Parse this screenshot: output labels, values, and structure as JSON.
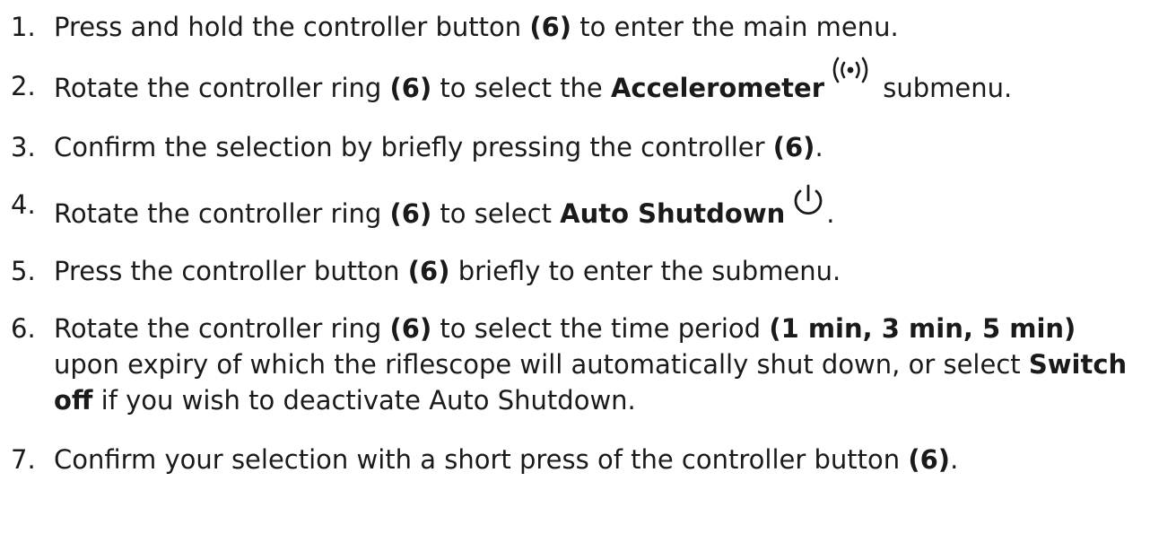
{
  "steps": [
    {
      "num": "1.",
      "t1": "Press and hold the controller button ",
      "b1": "(6)",
      "t2": " to enter the main menu."
    },
    {
      "num": "2.",
      "t1": "Rotate the controller ring ",
      "b1": "(6)",
      "t2": " to select the ",
      "b2": "Accelerometer",
      "icon": "accelerometer-signal-icon",
      "t3": " submenu."
    },
    {
      "num": "3.",
      "t1": "Confirm the selection by briefly pressing the controller ",
      "b1": "(6)",
      "t2": "."
    },
    {
      "num": "4.",
      "t1": "Rotate the controller ring ",
      "b1": "(6)",
      "t2": " to select ",
      "b2": "Auto Shutdown",
      "icon": "power-icon",
      "t3": "."
    },
    {
      "num": "5.",
      "t1": "Press the controller button ",
      "b1": "(6)",
      "t2": " briefly to enter the submenu."
    },
    {
      "num": "6.",
      "t1": "Rotate the controller ring ",
      "b1": "(6)",
      "t2": " to select the time period ",
      "b2": "(1 min, 3 min, 5 min)",
      "t3": " upon expiry of which the riflescope will automatically shut down, or select ",
      "b3": "Switch off",
      "t4": " if you wish to deactivate Auto Shutdown."
    },
    {
      "num": "7.",
      "t1": "Confirm your selection with a short press of the controller button ",
      "b1": "(6)",
      "t2": "."
    }
  ]
}
